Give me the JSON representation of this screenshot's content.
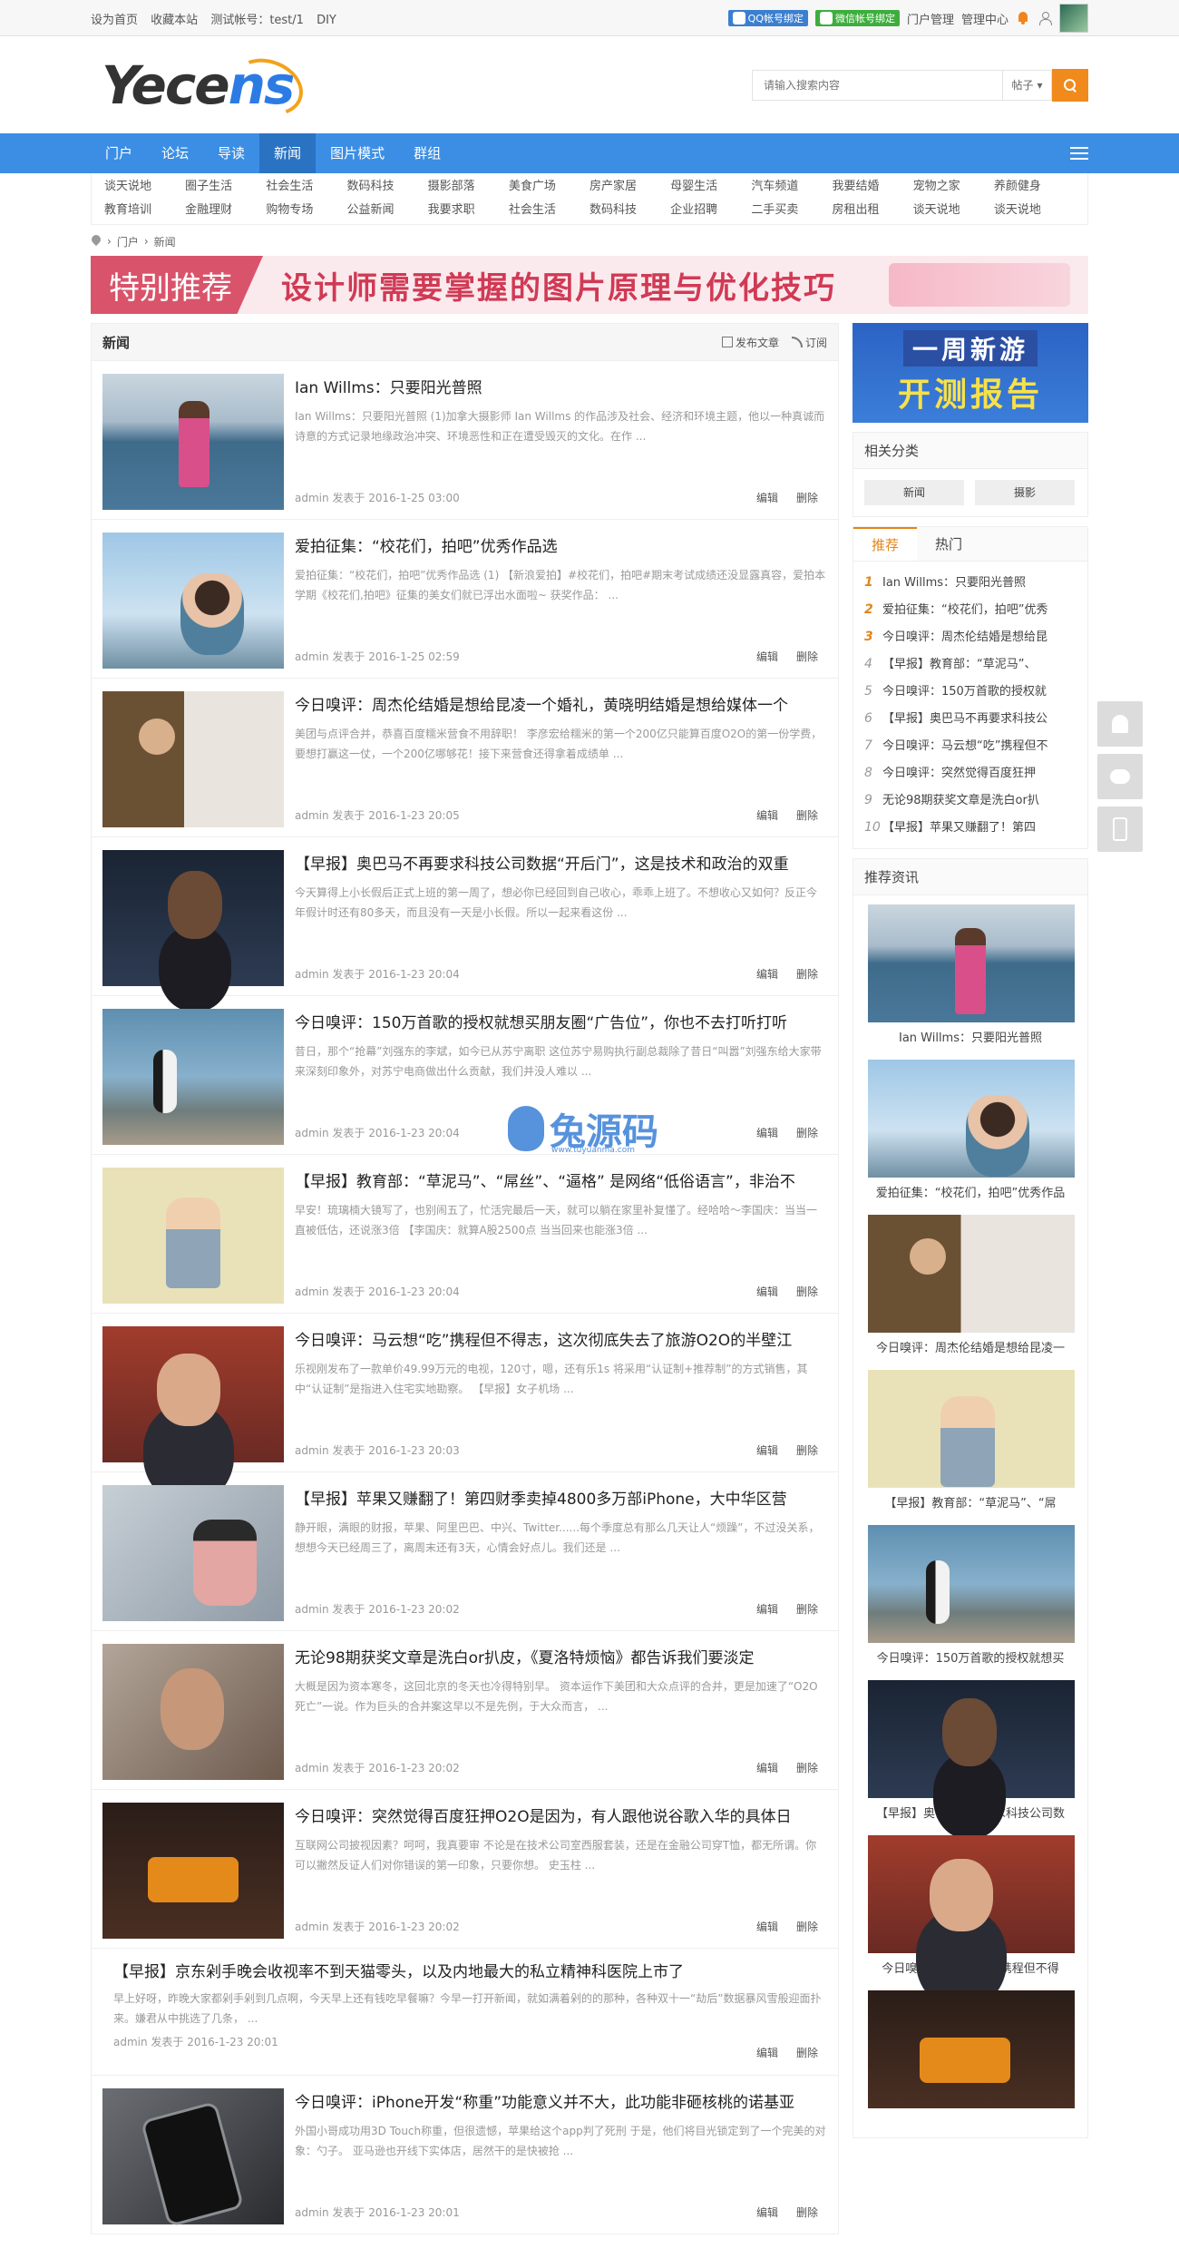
{
  "topbar": {
    "left": [
      "设为首页",
      "收藏本站",
      "测试帐号：test/1",
      "DIY"
    ],
    "qq_bind": "QQ帐号绑定",
    "wx_bind": "微信帐号绑定",
    "portal_manage": "门户管理",
    "manage_center": "管理中心"
  },
  "header": {
    "logo_dark": "Yece",
    "logo_blue": "ns",
    "search_placeholder": "请输入搜索内容",
    "search_type": "帖子"
  },
  "nav": {
    "items": [
      "门户",
      "论坛",
      "导读",
      "新闻",
      "图片模式",
      "群组"
    ],
    "active": "新闻"
  },
  "subcats": [
    "谈天说地",
    "圈子生活",
    "社会生活",
    "数码科技",
    "摄影部落",
    "美食广场",
    "房产家居",
    "母婴生活",
    "汽车频道",
    "我要结婚",
    "宠物之家",
    "养颜健身",
    "教育培训",
    "金融理财",
    "购物专场",
    "公益新闻",
    "我要求职",
    "社会生活",
    "数码科技",
    "企业招聘",
    "二手买卖",
    "房租出租",
    "谈天说地",
    "谈天说地"
  ],
  "breadcrumb": [
    "门户",
    "新闻"
  ],
  "banner": {
    "tag": "特别推荐",
    "headline": "设计师需要掌握的图片原理与优化技巧"
  },
  "content": {
    "title": "新闻",
    "post_label": "发布文章",
    "subscribe_label": "订阅",
    "edit_label": "编辑",
    "delete_label": "删除",
    "articles": [
      {
        "title": "Ian Willms：只要阳光普照",
        "summary": "Ian Willms：只要阳光普照 (1)加拿大摄影师 Ian Willms 的作品涉及社会、经济和环境主题，他以一种真诚而诗意的方式记录地缘政治冲突、环境恶性和正在遭受毁灭的文化。在作 ...",
        "meta": "admin  发表于  2016-1-25 03:00",
        "img": "sea"
      },
      {
        "title": "爱拍征集：“校花们，拍吧”优秀作品选",
        "summary": "爱拍征集：“校花们，拍吧”优秀作品选 (1) 【新浪爱拍】#校花们，拍吧#期末考试成绩还没显露真容，爱拍本学期《校花们,拍吧》征集的美女们就已浮出水面啦~    获奖作品： ...",
        "meta": "admin  发表于  2016-1-25 02:59",
        "img": "sky"
      },
      {
        "title": "今日嗅评：周杰伦结婚是想给昆凌一个婚礼，黄晓明结婚是想给媒体一个",
        "summary": "美团与点评合并，恭喜百度糯米营食不用辞职！    李彦宏给糯米的第一个200亿只能算百度O2O的第一份学费，要想打赢这一仗，一个200亿哪够花！接下来营食还得拿着成绩单 ...",
        "meta": "admin  发表于  2016-1-23 20:05",
        "img": "wedding"
      },
      {
        "title": "【早报】奥巴马不再要求科技公司数据“开后门”，这是技术和政治的双重",
        "summary": "今天算得上小长假后正式上班的第一周了，想必你已经回到自己收心，乖乖上班了。不想收心又如何？反正今年假计时还有80多天，而且没有一天是小长假。所以一起来看这份 ...",
        "meta": "admin  发表于  2016-1-23 20:04",
        "img": "obama"
      },
      {
        "title": "今日嗅评：150万首歌的授权就想买朋友圈“广告位”，你也不去打听打听",
        "summary": "昔日，那个“抢幕”刘强东的李斌，如今已从苏宁离职    这位苏宁易购执行副总裁除了昔日“叫嚣”刘强东给大家带来深刻印象外，对苏宁电商做出什么贡献，我们并没人难以 ...",
        "meta": "admin  发表于  2016-1-23 20:04",
        "img": "penguin"
      },
      {
        "title": "【早报】教育部：“草泥马”、“屌丝”、“逼格” 是网络“低俗语言”，非治不",
        "summary": "早安！琉璃楠大镜写了，也别闹五了，忙活完最后一天，就可以躺在家里补复懂了。经哈哈～李国庆：当当一直被低估，还说涨3倍    【李国庆：就算A股2500点 当当回来也能涨3倍 ...",
        "meta": "admin  发表于  2016-1-23 20:04",
        "img": "cartoon"
      },
      {
        "title": "今日嗅评：马云想“吃”携程但不得志，这次彻底失去了旅游O2O的半壁江",
        "summary": "乐视刚发布了一款单价49.99万元的电视，120寸，嗯，还有乐1s    将采用“认证制+推荐制”的方式销售，其中“认证制”是指进入住宅实地勘察。    【早报】女子机场 ...",
        "meta": "admin  发表于  2016-1-23 20:03",
        "img": "jack"
      },
      {
        "title": "【早报】苹果又赚翻了！第四财季卖掉4800多万部iPhone，大中华区营",
        "summary": "静开眼，满眼的财报，苹果、阿里巴巴、中兴、Twitter......每个季度总有那么几天让人“烦躁”，不过没关系，想想今天已经周三了，离周末还有3天，心情会好点儿。我们还是 ...",
        "meta": "admin  发表于  2016-1-23 20:02",
        "img": "cook"
      },
      {
        "title": "无论98期获奖文章是洗白or扒皮，《夏洛特烦恼》都告诉我们要淡定",
        "summary": "大概是因为资本寒冬，这回北京的冬天也冷得特别早。    资本运作下美团和大众点评的合并，更是加速了“O2O死亡”一说。作为巨头的合并案这早以不是先例，于大众而言， ...",
        "meta": "admin  发表于  2016-1-23 20:02",
        "img": "man"
      },
      {
        "title": "今日嗅评：突然觉得百度狂押O2O是因为，有人跟他说谷歌入华的具体日",
        "summary": "互联网公司披视因素？呵呵，我真要审    不论是在技术公司室西服套装，还是在金融公司穿T恤，都无所谓。你可以撇然反证人们对你错误的第一印象，只要你想。    史玉柱 ...",
        "meta": "admin  发表于  2016-1-23 20:02",
        "img": "cinema"
      },
      {
        "title": "【早报】京东剁手晚会收视率不到天猫零头，以及内地最大的私立精神科医院上市了",
        "summary": "早上好呀，昨晚大家都剁手剁到几点啊，今天早上还有钱吃早餐嘛？今早一打开新闻，就如满着剁的的那种，各种双十一“劫后”数据暴风雪般迎面扑来。嫌君从中挑选了几条， ...",
        "meta": "admin  发表于  2016-1-23 20:01",
        "img": ""
      },
      {
        "title": "今日嗅评：iPhone开发“称重”功能意义并不大，此功能非砸核桃的诺基亚",
        "summary": "外国小哥成功用3D Touch称重，但很遗憾，苹果给这个app判了死刑      于是，他们将目光锁定到了一个完美的对象：勺子。          亚马逊也开线下实体店，居然干的是快被抢 ...",
        "meta": "admin  发表于  2016-1-23 20:01",
        "img": "phone"
      }
    ]
  },
  "sidebar": {
    "ad_line1": "一周新游",
    "ad_line2": "开测报告",
    "related_title": "相关分类",
    "related": [
      "新闻",
      "摄影"
    ],
    "tabs": [
      "推荐",
      "热门"
    ],
    "rank": [
      "Ian Willms：只要阳光普照",
      "爱拍征集：“校花们，拍吧”优秀",
      "今日嗅评：周杰伦结婚是想给昆",
      "【早报】教育部：“草泥马”、",
      "今日嗅评：150万首歌的授权就",
      "【早报】奥巴马不再要求科技公",
      "今日嗅评：马云想“吃”携程但不",
      "今日嗅评：突然觉得百度狂押",
      "无论98期获奖文章是洗白or扒",
      "【早报】苹果又赚翻了！第四"
    ],
    "rec_title": "推荐资讯",
    "rec": [
      {
        "cap": "Ian Willms：只要阳光普照",
        "img": "sea"
      },
      {
        "cap": "爱拍征集：“校花们，拍吧”优秀作品",
        "img": "sky"
      },
      {
        "cap": "今日嗅评：周杰伦结婚是想给昆凌一",
        "img": "wedding"
      },
      {
        "cap": "【早报】教育部：“草泥马”、“屌",
        "img": "cartoon"
      },
      {
        "cap": "今日嗅评：150万首歌的授权就想买",
        "img": "penguin"
      },
      {
        "cap": "【早报】奥巴马不再要求科技公司数",
        "img": "obama"
      },
      {
        "cap": "今日嗅评：马云想“吃”携程但不得",
        "img": "jack"
      },
      {
        "cap": "",
        "img": "cinema"
      }
    ]
  },
  "watermark": {
    "text": "兔源码",
    "sub": "www.tuyuanma.com"
  }
}
